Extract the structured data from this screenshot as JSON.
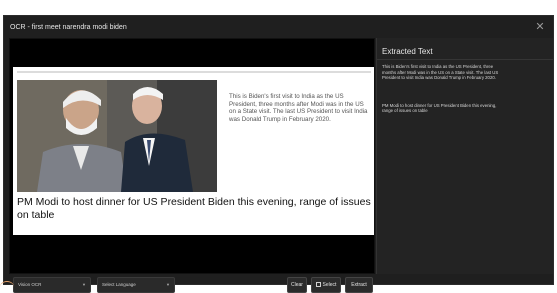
{
  "window": {
    "title": "OCR - first meet narendra modi biden",
    "close_icon": "close-icon"
  },
  "document": {
    "photo_alt": "Modi and Biden",
    "paragraph": "This is Biden's first visit to India as the US President, three months after Modi was in the US on a State visit. The last US President to visit India was Donald Trump in February 2020.",
    "headline": "PM Modi to host dinner for US President Biden this evening, range of issues on table"
  },
  "panel": {
    "title": "Extracted Text",
    "paragraphs": [
      "This is Biden's first visit to India as the US President, three months after Modi was in the US on a State visit. The last US President to visit India was Donald Trump in February 2020.",
      "PM Modi to host dinner for US President Biden this evening, range of issues on table"
    ]
  },
  "controls": {
    "engine_select": "Vision OCR",
    "language_select": "Select Language",
    "clear_label": "Clear",
    "select_label": "Select",
    "extract_label": "Extract"
  },
  "colors": {
    "window_bg": "#1f1f1f",
    "panel_bg": "#232323",
    "accent": "#e8a36a"
  }
}
